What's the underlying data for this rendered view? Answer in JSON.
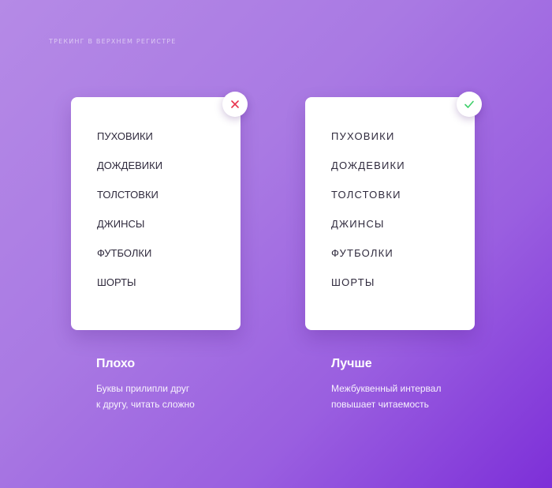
{
  "heading": "ТРЕКИНГ В ВЕРХНЕМ РЕГИСТРЕ",
  "colors": {
    "bad_icon": "#e8344e",
    "good_icon": "#3ecf6a",
    "card_text": "#2f2a3d"
  },
  "examples": [
    {
      "icon": "close-icon",
      "items": [
        "ПУХОВИКИ",
        "ДОЖДЕВИКИ",
        "ТОЛСТОВКИ",
        "ДЖИНСЫ",
        "ФУТБОЛКИ",
        "ШОРТЫ"
      ],
      "title": "Плохо",
      "description_line1": "Буквы прилипли друг",
      "description_line2": "к другу, читать сложно"
    },
    {
      "icon": "check-icon",
      "items": [
        "ПУХОВИКИ",
        "ДОЖДЕВИКИ",
        "ТОЛСТОВКИ",
        "ДЖИНСЫ",
        "ФУТБОЛКИ",
        "ШОРТЫ"
      ],
      "title": "Лучше",
      "description_line1": "Межбуквенный интервал",
      "description_line2": "повышает читаемость"
    }
  ]
}
